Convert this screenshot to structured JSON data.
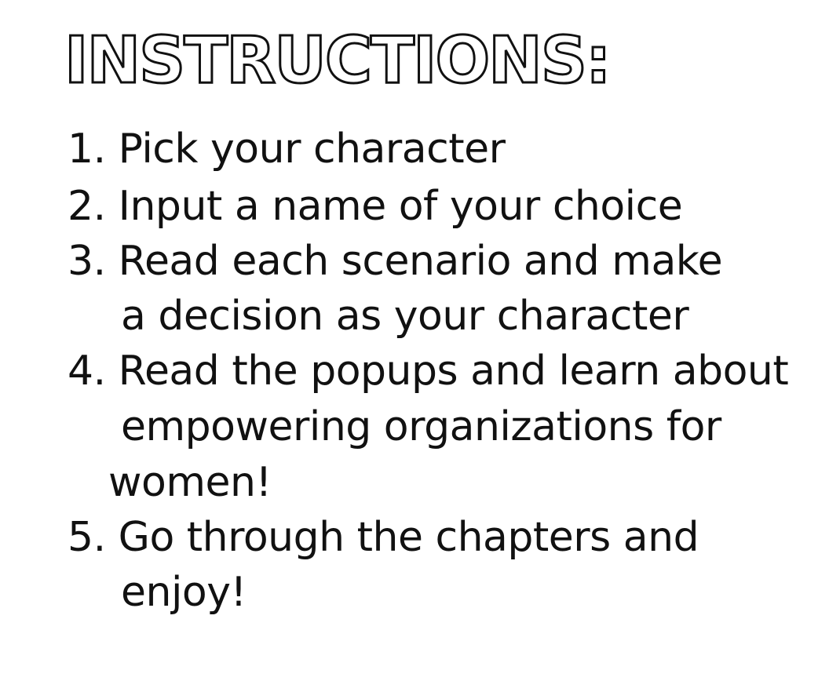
{
  "title": "INSTRUCTIONS:",
  "steps": [
    {
      "number": "1.",
      "lines": [
        "Pick your character"
      ]
    },
    {
      "number": "2.",
      "lines": [
        "Input a name of your choice"
      ]
    },
    {
      "number": "3.",
      "lines": [
        "Read each scenario and make",
        "a decision as your character"
      ]
    },
    {
      "number": "4.",
      "lines": [
        "Read the popups and learn about",
        "empowering organizations for",
        "women!"
      ]
    },
    {
      "number": "5.",
      "lines": [
        "Go through the chapters and",
        "enjoy!"
      ]
    }
  ],
  "rendered_lines": [
    "1. Pick your character",
    "2. Input a name of your choice",
    "3. Read each scenario and make",
    "a decision as your character",
    "4. Read the popups and learn about",
    "empowering organizations for",
    "women!",
    "5. Go through the chapters and",
    "enjoy!"
  ]
}
